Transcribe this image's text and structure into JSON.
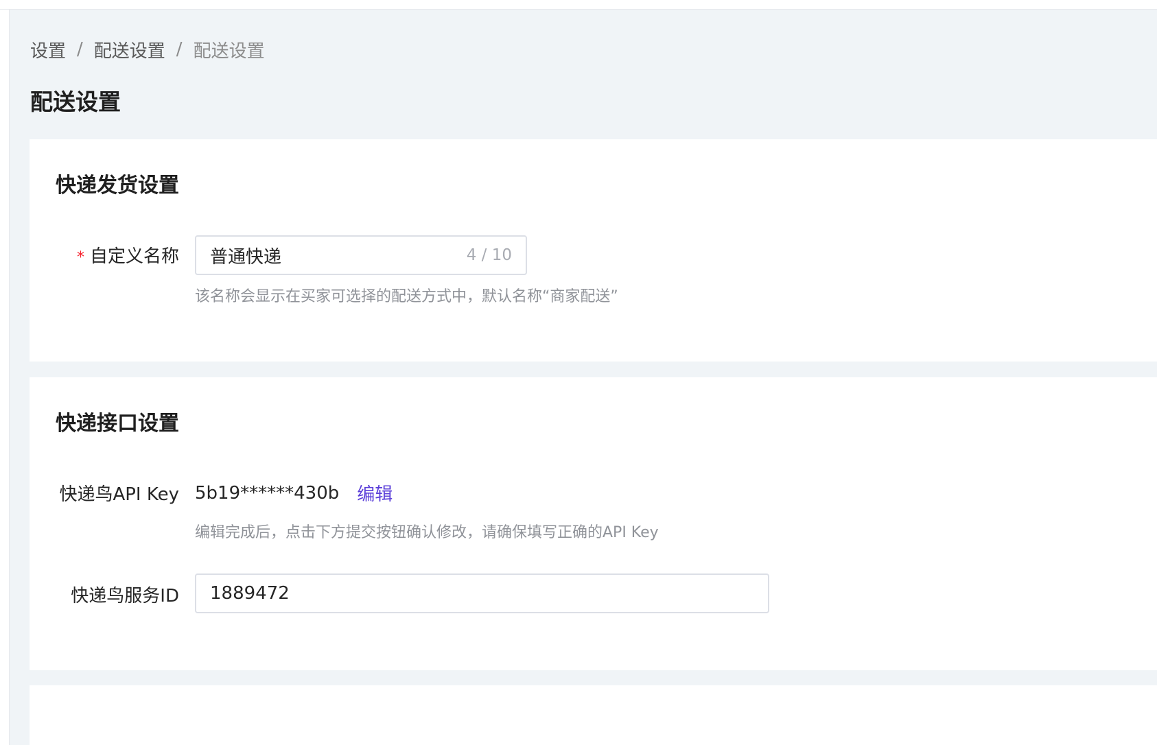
{
  "breadcrumb": {
    "items": [
      "设置",
      "配送设置",
      "配送设置"
    ],
    "separator": "/"
  },
  "page_title": "配送设置",
  "express_delivery": {
    "title": "快递发货设置",
    "custom_name": {
      "required_mark": "*",
      "label": "自定义名称",
      "value": "普通快递",
      "counter": "4 / 10",
      "hint": "该名称会显示在买家可选择的配送方式中，默认名称“商家配送”"
    }
  },
  "express_api": {
    "title": "快递接口设置",
    "api_key": {
      "label": "快递鸟API Key",
      "value": "5b19******430b",
      "edit_label": "编辑",
      "hint": "编辑完成后，点击下方提交按钮确认修改，请确保填写正确的API Key"
    },
    "service_id": {
      "label": "快递鸟服务ID",
      "value": "1889472"
    }
  },
  "colors": {
    "background": "#f0f4f7",
    "card": "#ffffff",
    "link": "#5b3fd9",
    "required": "#f5222d",
    "hint": "#909399"
  }
}
